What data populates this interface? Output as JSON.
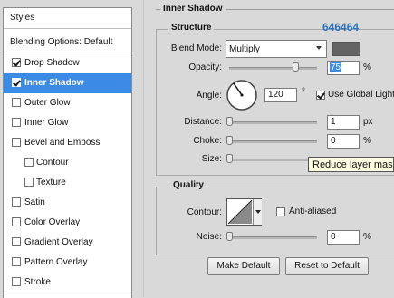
{
  "styles_list": {
    "header": "Styles",
    "blending_options": "Blending Options: Default",
    "items": [
      {
        "label": "Drop Shadow",
        "checked": true,
        "selected": false,
        "sub": false
      },
      {
        "label": "Inner Shadow",
        "checked": true,
        "selected": true,
        "sub": false
      },
      {
        "label": "Outer Glow",
        "checked": false,
        "selected": false,
        "sub": false
      },
      {
        "label": "Inner Glow",
        "checked": false,
        "selected": false,
        "sub": false
      },
      {
        "label": "Bevel and Emboss",
        "checked": false,
        "selected": false,
        "sub": false
      },
      {
        "label": "Contour",
        "checked": false,
        "selected": false,
        "sub": true
      },
      {
        "label": "Texture",
        "checked": false,
        "selected": false,
        "sub": true
      },
      {
        "label": "Satin",
        "checked": false,
        "selected": false,
        "sub": false
      },
      {
        "label": "Color Overlay",
        "checked": false,
        "selected": false,
        "sub": false
      },
      {
        "label": "Gradient Overlay",
        "checked": false,
        "selected": false,
        "sub": false
      },
      {
        "label": "Pattern Overlay",
        "checked": false,
        "selected": false,
        "sub": false
      },
      {
        "label": "Stroke",
        "checked": false,
        "selected": false,
        "sub": false
      }
    ]
  },
  "inner_shadow": {
    "title": "Inner Shadow",
    "structure": {
      "title": "Structure",
      "color_annotation": "646464",
      "shadow_color": "#646464",
      "blend_mode_label": "Blend Mode:",
      "blend_mode_value": "Multiply",
      "opacity_label": "Opacity:",
      "opacity_value": "75",
      "opacity_level": 0.75,
      "percent": "%",
      "angle_label": "Angle:",
      "angle_value": "120",
      "degree": "°",
      "global_light_label": "Use Global Light",
      "global_light_checked": true,
      "distance_label": "Distance:",
      "distance_value": "1",
      "distance_unit": "px",
      "distance_level": 0.0,
      "choke_label": "Choke:",
      "choke_value": "0",
      "choke_unit": "%",
      "choke_level": 0.0,
      "size_label": "Size:",
      "size_level": 0.0,
      "tooltip": "Reduce layer mas"
    },
    "quality": {
      "title": "Quality",
      "contour_label": "Contour:",
      "anti_aliased_label": "Anti-aliased",
      "anti_aliased_checked": false,
      "noise_label": "Noise:",
      "noise_value": "0",
      "noise_unit": "%",
      "noise_level": 0.0
    },
    "buttons": {
      "make_default": "Make Default",
      "reset_default": "Reset to Default"
    }
  },
  "colors": {
    "selection": "#3b8be6",
    "annotation": "#2a72c0"
  }
}
